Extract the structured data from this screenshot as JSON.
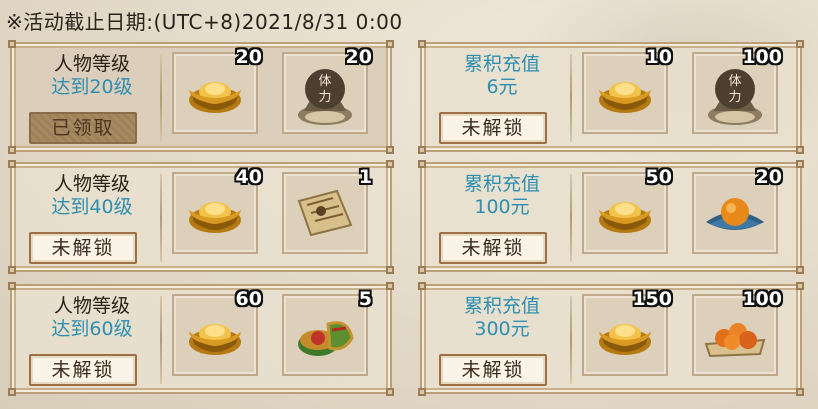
{
  "deadline": "※活动截止日期:(UTC+8)2021/8/31 0:00",
  "colors": {
    "highlight": "#2e8fb1",
    "text": "#2c2118",
    "frame": "#b9a079"
  },
  "cards": [
    {
      "line1": "人物等级",
      "line2": "达到20级",
      "button": "已领取",
      "claimed": true,
      "rewards": [
        {
          "icon": "gold-ingot-icon",
          "qty": "20"
        },
        {
          "icon": "stamina-bag-icon",
          "qty": "20"
        }
      ]
    },
    {
      "line1": "累积充值",
      "line2": "6元",
      "button": "未解锁",
      "claimed": false,
      "rewards": [
        {
          "icon": "gold-ingot-icon",
          "qty": "10"
        },
        {
          "icon": "stamina-bag-icon",
          "qty": "100"
        }
      ]
    },
    {
      "line1": "人物等级",
      "line2": "达到40级",
      "button": "未解锁",
      "claimed": false,
      "rewards": [
        {
          "icon": "gold-ingot-icon",
          "qty": "40"
        },
        {
          "icon": "scroll-map-icon",
          "qty": "1"
        }
      ]
    },
    {
      "line1": "累积充值",
      "line2": "100元",
      "button": "未解锁",
      "claimed": false,
      "rewards": [
        {
          "icon": "gold-ingot-icon",
          "qty": "50"
        },
        {
          "icon": "orange-cushion-icon",
          "qty": "20"
        }
      ]
    },
    {
      "line1": "人物等级",
      "line2": "达到60级",
      "button": "未解锁",
      "claimed": false,
      "rewards": [
        {
          "icon": "gold-ingot-icon",
          "qty": "60"
        },
        {
          "icon": "treasure-box-icon",
          "qty": "5"
        }
      ]
    },
    {
      "line1": "累积充值",
      "line2": "300元",
      "button": "未解锁",
      "claimed": false,
      "rewards": [
        {
          "icon": "gold-ingot-icon",
          "qty": "150"
        },
        {
          "icon": "fruit-platter-icon",
          "qty": "100"
        }
      ]
    }
  ],
  "stamina_glyphs": "体力"
}
